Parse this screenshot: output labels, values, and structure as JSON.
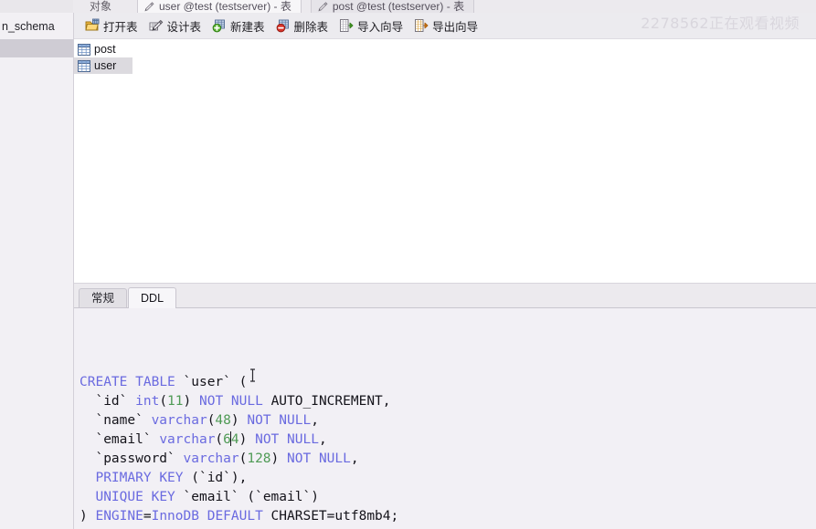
{
  "window": {
    "object_tab_label": "对象",
    "document_tabs": [
      {
        "label": "user @test (testserver) - 表",
        "active": true,
        "icon": "table-design-pencil-icon"
      },
      {
        "label": "post @test (testserver) - 表",
        "active": false,
        "icon": "table-design-pencil-icon"
      }
    ]
  },
  "watermark": {
    "text": "2278562正在观看视频",
    "color": "#d9d6dd"
  },
  "sidebar": {
    "schema_label": "n_schema"
  },
  "toolbar": {
    "buttons": [
      {
        "label": "打开表",
        "icon": "open-table-icon"
      },
      {
        "label": "设计表",
        "icon": "design-table-icon"
      },
      {
        "label": "新建表",
        "icon": "new-table-icon"
      },
      {
        "label": "删除表",
        "icon": "delete-table-icon"
      },
      {
        "label": "导入向导",
        "icon": "import-wizard-icon"
      },
      {
        "label": "导出向导",
        "icon": "export-wizard-icon"
      }
    ]
  },
  "table_list": {
    "items": [
      {
        "name": "post",
        "selected": false,
        "icon": "table-grid-icon"
      },
      {
        "name": "user",
        "selected": true,
        "icon": "table-grid-icon"
      }
    ]
  },
  "bottom_tabs": [
    {
      "label": "常规",
      "active": false
    },
    {
      "label": "DDL",
      "active": true
    }
  ],
  "ddl": {
    "syntax_colors": {
      "keyword": "#6a6ae0",
      "number": "#4f9a55",
      "plain": "#14131a",
      "editor_background": "#f2f0f5"
    },
    "caret_line": 3,
    "caret_after_text": "varchar(6",
    "lines": [
      {
        "tokens": [
          {
            "t": "CREATE",
            "k": "kw"
          },
          {
            "t": " ",
            "k": "pln"
          },
          {
            "t": "TABLE",
            "k": "kw"
          },
          {
            "t": " `user` (",
            "k": "pln"
          }
        ]
      },
      {
        "tokens": [
          {
            "t": "  `id` ",
            "k": "pln"
          },
          {
            "t": "int",
            "k": "kw"
          },
          {
            "t": "(",
            "k": "pln"
          },
          {
            "t": "11",
            "k": "num"
          },
          {
            "t": ") ",
            "k": "pln"
          },
          {
            "t": "NOT",
            "k": "kw"
          },
          {
            "t": " ",
            "k": "pln"
          },
          {
            "t": "NULL",
            "k": "kw"
          },
          {
            "t": " AUTO_INCREMENT,",
            "k": "pln"
          }
        ]
      },
      {
        "tokens": [
          {
            "t": "  `name` ",
            "k": "pln"
          },
          {
            "t": "varchar",
            "k": "kw"
          },
          {
            "t": "(",
            "k": "pln"
          },
          {
            "t": "48",
            "k": "num"
          },
          {
            "t": ") ",
            "k": "pln"
          },
          {
            "t": "NOT",
            "k": "kw"
          },
          {
            "t": " ",
            "k": "pln"
          },
          {
            "t": "NULL",
            "k": "kw"
          },
          {
            "t": ",",
            "k": "pln"
          }
        ]
      },
      {
        "tokens": [
          {
            "t": "  `email` ",
            "k": "pln"
          },
          {
            "t": "varchar",
            "k": "kw"
          },
          {
            "t": "(",
            "k": "pln"
          },
          {
            "t": "6",
            "k": "num"
          },
          {
            "t": "|CARET|",
            "k": "caret"
          },
          {
            "t": "4",
            "k": "num"
          },
          {
            "t": ") ",
            "k": "pln"
          },
          {
            "t": "NOT",
            "k": "kw"
          },
          {
            "t": " ",
            "k": "pln"
          },
          {
            "t": "NULL",
            "k": "kw"
          },
          {
            "t": ",",
            "k": "pln"
          }
        ]
      },
      {
        "tokens": [
          {
            "t": "  `password` ",
            "k": "pln"
          },
          {
            "t": "varchar",
            "k": "kw"
          },
          {
            "t": "(",
            "k": "pln"
          },
          {
            "t": "128",
            "k": "num"
          },
          {
            "t": ") ",
            "k": "pln"
          },
          {
            "t": "NOT",
            "k": "kw"
          },
          {
            "t": " ",
            "k": "pln"
          },
          {
            "t": "NULL",
            "k": "kw"
          },
          {
            "t": ",",
            "k": "pln"
          }
        ]
      },
      {
        "tokens": [
          {
            "t": "  ",
            "k": "pln"
          },
          {
            "t": "PRIMARY",
            "k": "kw"
          },
          {
            "t": " ",
            "k": "pln"
          },
          {
            "t": "KEY",
            "k": "kw"
          },
          {
            "t": " (`id`),",
            "k": "pln"
          }
        ]
      },
      {
        "tokens": [
          {
            "t": "  ",
            "k": "pln"
          },
          {
            "t": "UNIQUE",
            "k": "kw"
          },
          {
            "t": " ",
            "k": "pln"
          },
          {
            "t": "KEY",
            "k": "kw"
          },
          {
            "t": " `email` (`email`)",
            "k": "pln"
          }
        ]
      },
      {
        "tokens": [
          {
            "t": ") ",
            "k": "pln"
          },
          {
            "t": "ENGINE",
            "k": "kw"
          },
          {
            "t": "=",
            "k": "pln"
          },
          {
            "t": "InnoDB",
            "k": "kw"
          },
          {
            "t": " ",
            "k": "pln"
          },
          {
            "t": "DEFAULT",
            "k": "kw"
          },
          {
            "t": " CHARSET=utf8mb4;",
            "k": "pln"
          }
        ]
      }
    ]
  }
}
